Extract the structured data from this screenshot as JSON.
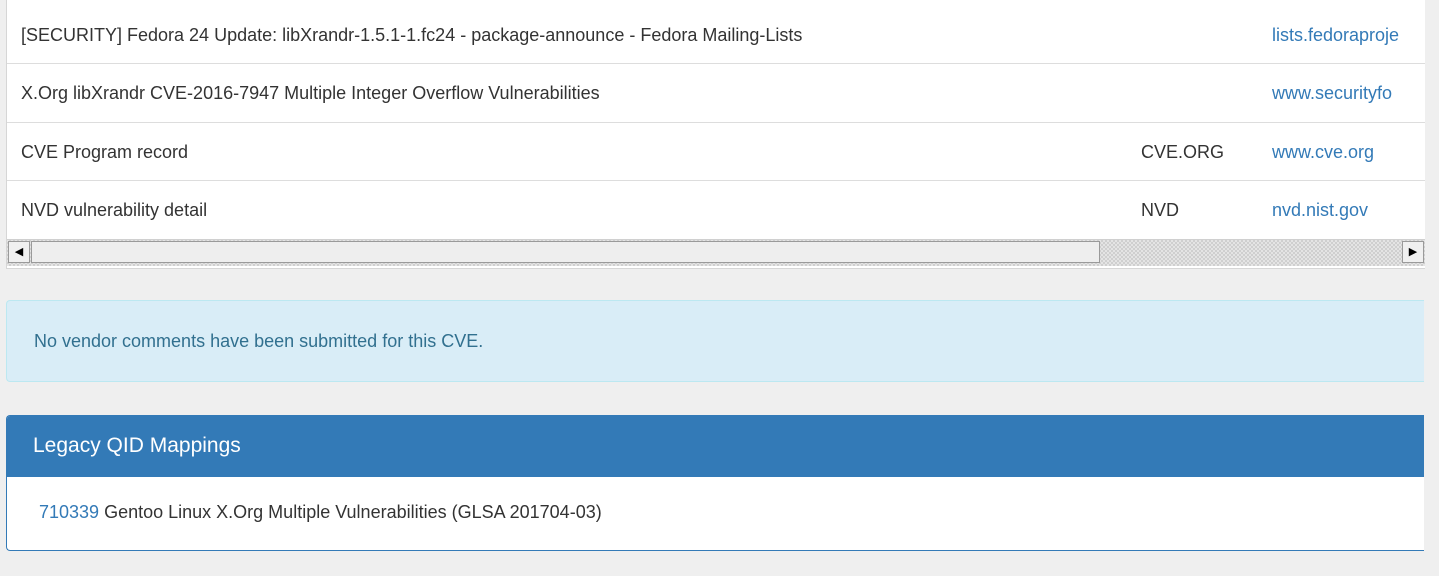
{
  "references": {
    "rows": [
      {
        "title": "[SECURITY] Fedora 24 Update: libXrandr-1.5.1-1.fc24 - package-announce - Fedora Mailing-Lists",
        "source": "",
        "link": "lists.fedoraproje"
      },
      {
        "title": "X.Org libXrandr CVE-2016-7947 Multiple Integer Overflow Vulnerabilities",
        "source": "",
        "link": "www.securityfo"
      },
      {
        "title": "CVE Program record",
        "source": "CVE.ORG",
        "link": "www.cve.org"
      },
      {
        "title": "NVD vulnerability detail",
        "source": "NVD",
        "link": "nvd.nist.gov"
      }
    ],
    "scrollbar": {
      "left_arrow_icon": "triangle-left-icon",
      "right_arrow_icon": "triangle-right-icon",
      "left_arrow_glyph": "◀",
      "right_arrow_glyph": "▶"
    }
  },
  "vendor_comments": {
    "message": "No vendor comments have been submitted for this CVE."
  },
  "legacy_qid": {
    "heading": "Legacy QID Mappings",
    "items": [
      {
        "qid": "710339",
        "title": "Gentoo Linux X.Org Multiple Vulnerabilities (GLSA 201704-03)"
      }
    ]
  },
  "colors": {
    "link": "#337ab7",
    "panel_heading": "#337ab7",
    "alert_bg": "#d9edf7",
    "alert_text": "#31708f",
    "page_bg": "#efefef"
  }
}
